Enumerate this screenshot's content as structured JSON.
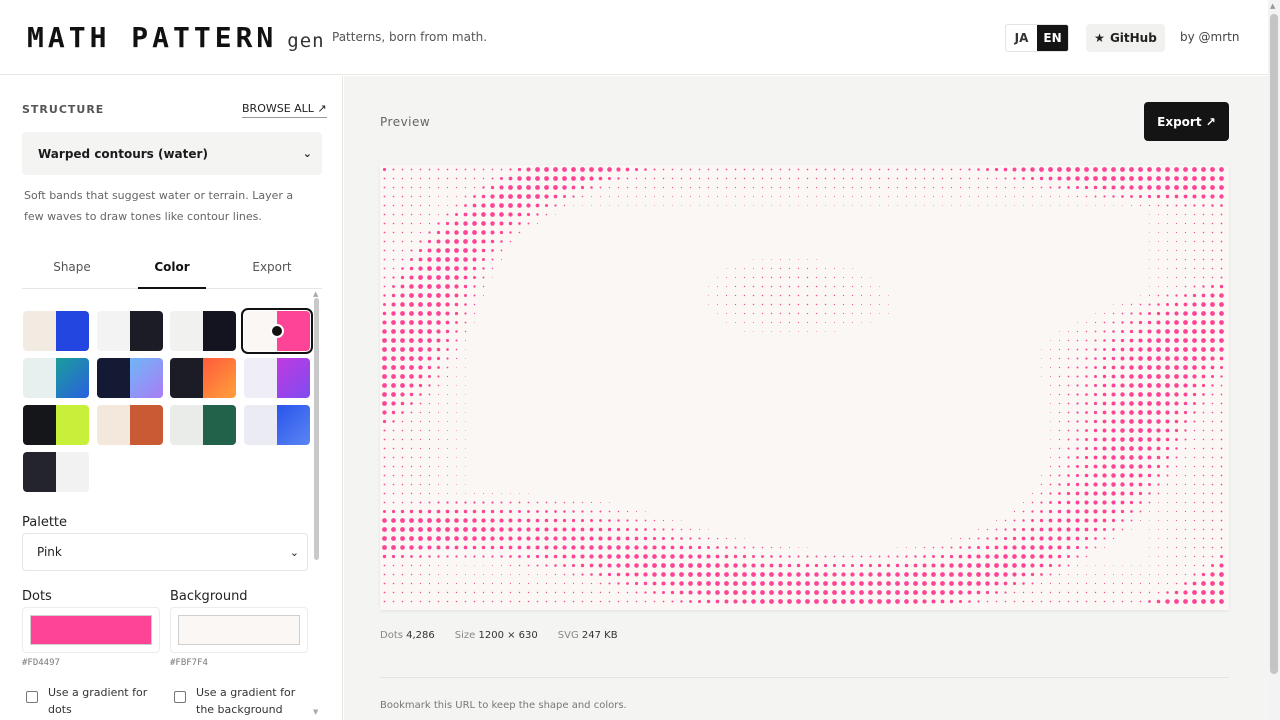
{
  "header": {
    "logo_main": "MATH PATTERN",
    "logo_sub": "gen",
    "tagline": "Patterns, born from math.",
    "lang_ja": "JA",
    "lang_en": "EN",
    "github_icon": "★",
    "github_label": "GitHub",
    "by": "by @mrtn"
  },
  "sidebar": {
    "section_title": "STRUCTURE",
    "browse_all": "BROWSE ALL ↗",
    "structure_value": "Warped contours (water)",
    "description": "Soft bands that suggest water or terrain. Layer a few waves to draw tones like contour lines.",
    "tabs": [
      "Shape",
      "Color",
      "Export"
    ],
    "active_tab": "Color",
    "swatches": [
      {
        "a": "#f1ebe2",
        "b": "#2346e0"
      },
      {
        "a": "#f3f3f3",
        "b": "#1b1c25"
      },
      {
        "a": "#f1f1ef",
        "b": "#141420"
      },
      {
        "a": "#fbf7f4",
        "b": "#fd4497",
        "selected": true
      },
      {
        "a": "#e8f0ef",
        "b": "linear-gradient(135deg,#1a9e9a,#2b5fe0)"
      },
      {
        "a": "#141a33",
        "b": "linear-gradient(135deg,#6fb6f6,#a97cf5)"
      },
      {
        "a": "#1c1c27",
        "b": "linear-gradient(135deg,#ff5a3c,#ffa13a)"
      },
      {
        "a": "#efedf8",
        "b": "linear-gradient(135deg,#c13ae0,#7d4cf0)"
      },
      {
        "a": "#15161a",
        "b": "#c8f03a"
      },
      {
        "a": "#f4e8dc",
        "b": "#c85a34"
      },
      {
        "a": "#e9ece9",
        "b": "#22614a"
      },
      {
        "a": "#ebebf4",
        "b": "linear-gradient(135deg,#2a54ea,#5a86f5)"
      },
      {
        "a": "#24242f",
        "b": "#f2f2f2"
      }
    ],
    "palette_label": "Palette",
    "palette_value": "Pink",
    "dots_label": "Dots",
    "dots_color": "#FD4497",
    "dots_hex": "#FD4497",
    "bg_label": "Background",
    "bg_color": "#FBF7F4",
    "bg_hex": "#FBF7F4",
    "gradient_dots": "Use a gradient for dots",
    "gradient_bg": "Use a gradient for the background"
  },
  "main": {
    "preview_label": "Preview",
    "export_label": "Export ↗",
    "stats_dots_label": "Dots",
    "stats_dots_value": "4,286",
    "stats_size_label": "Size",
    "stats_size_value": "1200 × 630",
    "stats_svg_label": "SVG",
    "stats_svg_value": "247 KB",
    "bookmark": "Bookmark this URL to keep the shape and colors."
  }
}
